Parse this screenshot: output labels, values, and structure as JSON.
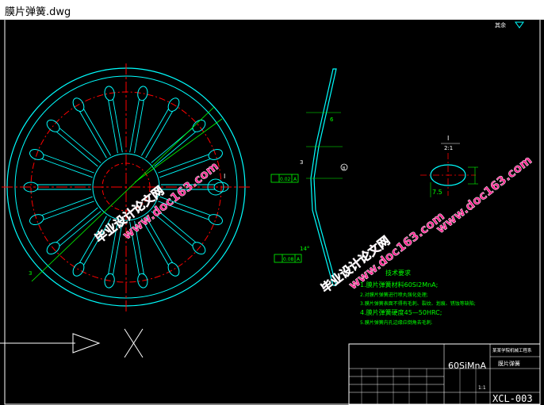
{
  "window": {
    "title": "膜片弹簧.dwg"
  },
  "colors": {
    "background": "#000000",
    "frame": "#ffffff",
    "outline": "#00ffff",
    "centerline": "#ff0000",
    "dimension": "#00ff00",
    "watermark": "#ff1f8f",
    "note_text": "#00ff00",
    "symbol": "#ffff00"
  },
  "drawing": {
    "roughness_mark": "其余",
    "section_label_right": "I",
    "dim_angle_left": "3",
    "dim_slot": "6",
    "dim_top": "1",
    "dim_thickness": "3",
    "tolerance_flat_1": "0.02",
    "tolerance_flat_1_datum": "A",
    "tolerance_flat_2": "0.08",
    "tolerance_flat_2_datum": "A",
    "angle_label": "14°",
    "detail_label": "I",
    "detail_scale": "2:1",
    "detail_dim_width": "7.5",
    "section_marker": "B"
  },
  "notes": {
    "heading": "技术要求",
    "items": [
      "1.膜片弹簧材料60Si2MnA;",
      "2.对膜片弹簧进行喷丸强化处理;",
      "3.膜片弹簧表面不得有毛刺、裂纹、划痕、锈蚀等缺陷;",
      "4.膜片弹簧硬度45—50HRC;",
      "5.膜片弹簧内孔边缘应倒角去毛刺."
    ]
  },
  "title_block": {
    "material": "60SiMnA",
    "school": "某某学院机械工程系",
    "part_name": "膜片弹簧",
    "scale": "1:1",
    "drawing_no": "XCL-003"
  },
  "watermarks": [
    {
      "line1": "毕业设计论文网",
      "line2": "www.doc163.com"
    },
    {
      "line1": "毕业设计论文网",
      "line2": "www.doc163.com"
    },
    {
      "line1": "毕业设计论文网",
      "line2": "www.doc163.com"
    }
  ]
}
